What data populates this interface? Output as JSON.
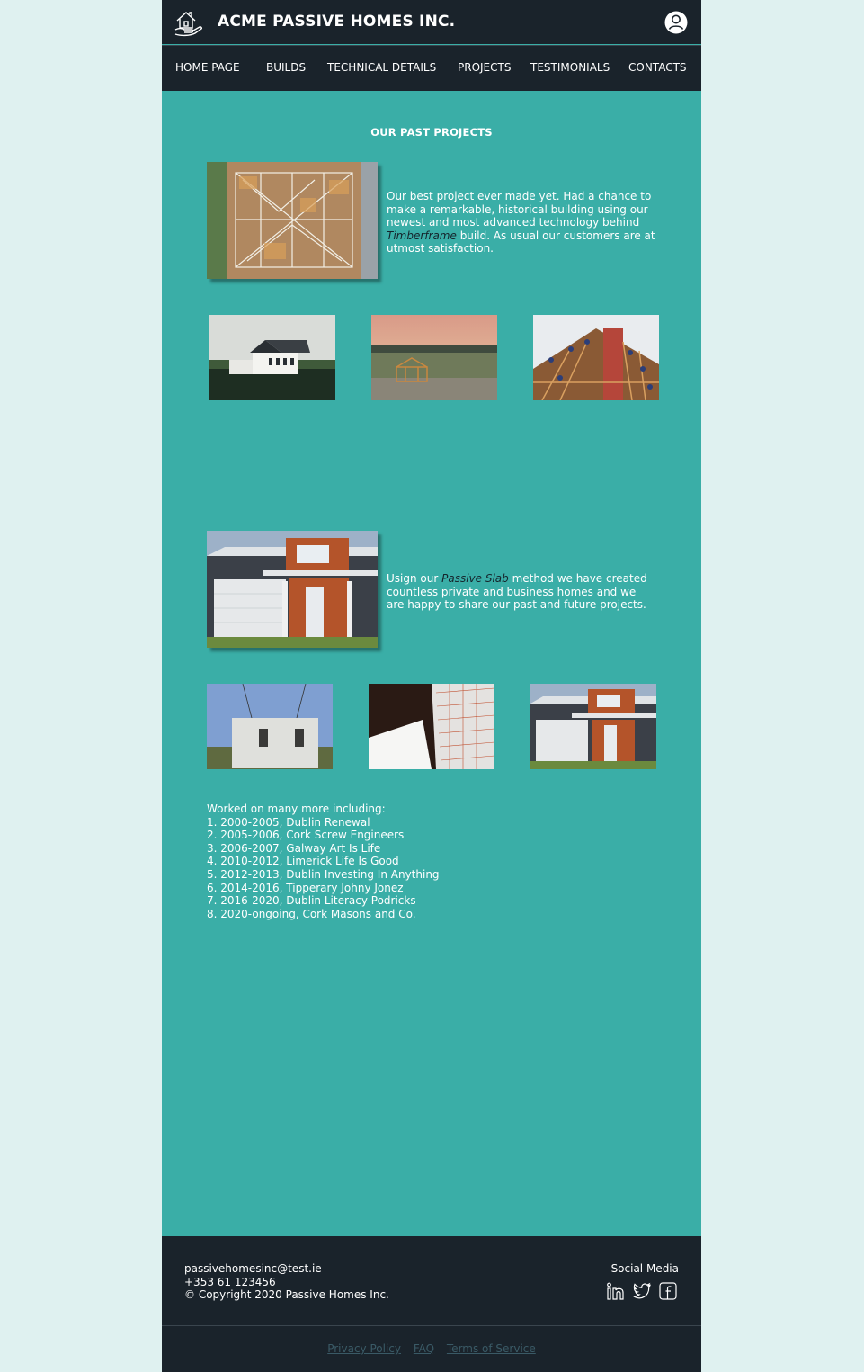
{
  "header": {
    "brand": "ACME PASSIVE HOMES INC.",
    "logo_icon": "house-in-hand-icon",
    "account_icon": "user-avatar-icon"
  },
  "nav": {
    "items": [
      "HOME PAGE",
      "BUILDS",
      "TECHNICAL DETAILS",
      "PROJECTS",
      "TESTIMONIALS",
      "CONTACTS"
    ]
  },
  "main": {
    "title": "OUR PAST PROJECTS",
    "project1": {
      "text_before": "Our best project ever made yet. Had a chance to make a remarkable, historical building using our newest and most advanced technology behind ",
      "emphasis": "Timberframe",
      "text_after": " build. As usual our customers are at utmost satisfaction."
    },
    "project2": {
      "text_before": "Usign our ",
      "emphasis": "Passive Slab",
      "text_after": " method we have created countless private and business homes and we are happy to share our past and future projects."
    },
    "more": {
      "intro": "Worked on many more including:",
      "items": [
        "1. 2000-2005, Dublin Renewal",
        "2. 2005-2006, Cork Screw Engineers",
        "3. 2006-2007, Galway Art Is Life",
        "4. 2010-2012, Limerick Life Is Good",
        "5. 2012-2013, Dublin Investing In Anything",
        "6. 2014-2016, Tipperary Johny Jonez",
        "7. 2016-2020, Dublin Literacy Podricks",
        "8. 2020-ongoing, Cork Masons and Co."
      ]
    }
  },
  "footer": {
    "email": "passivehomesinc@test.ie",
    "phone": "+353 61 123456",
    "copyright": "© Copyright 2020 Passive Homes Inc.",
    "social_label": "Social Media",
    "social_icons": [
      "linkedin-icon",
      "twitter-icon",
      "facebook-icon"
    ],
    "links": [
      "Privacy Policy",
      "FAQ",
      "Terms of Service"
    ]
  },
  "colors": {
    "header_bg": "#1a232b",
    "content_bg": "#3aaea7",
    "page_bg": "#dff1f0",
    "emphasis_text": "#15252c",
    "footer_link": "#3a5a66"
  }
}
